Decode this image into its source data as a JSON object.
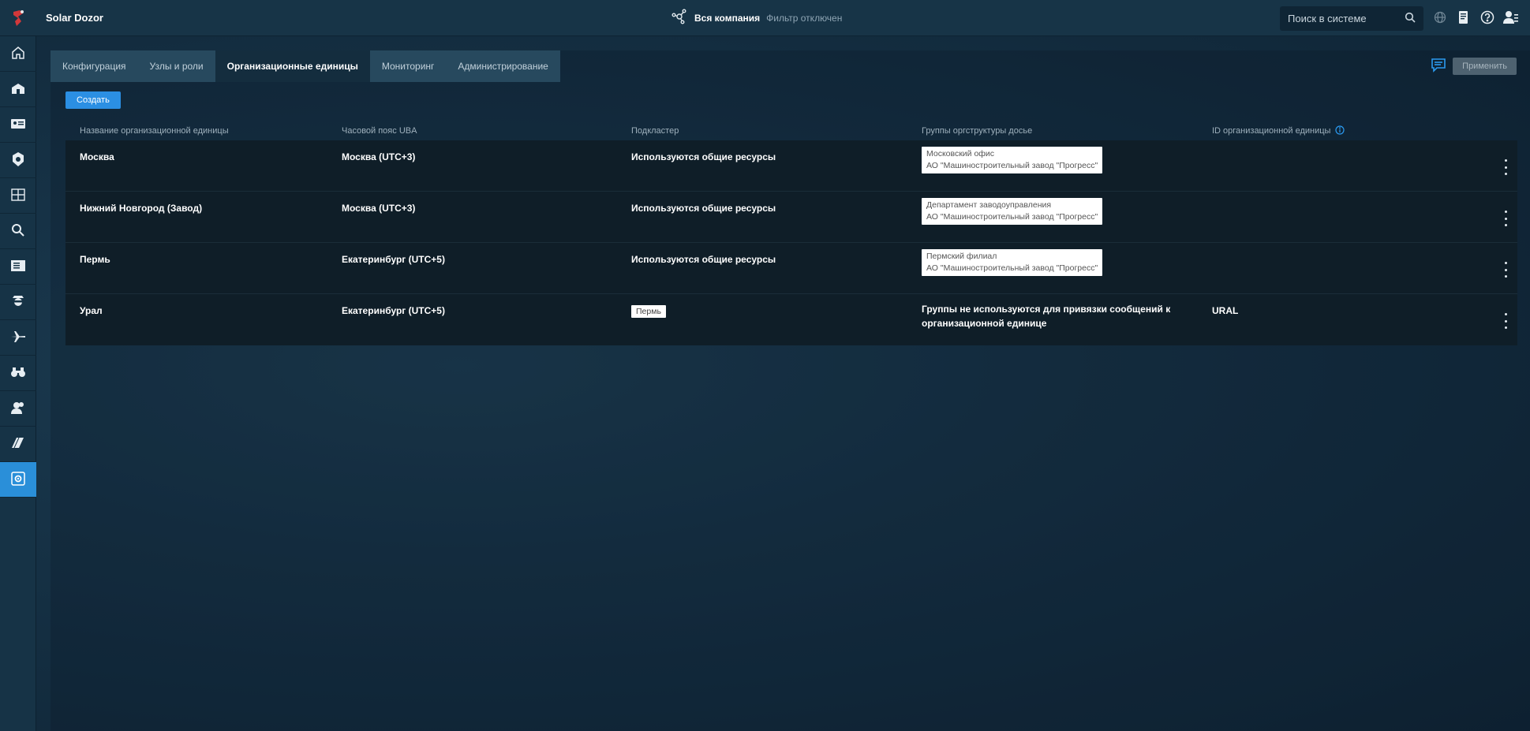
{
  "app": {
    "title": "Solar Dozor",
    "company_label": "Вся компания",
    "filter_state": "Фильтр отключен",
    "search_placeholder": "Поиск в системе"
  },
  "sidebar": {
    "items": [
      {
        "icon": "home-icon"
      },
      {
        "icon": "building-icon"
      },
      {
        "icon": "id-card-icon"
      },
      {
        "icon": "badge-icon"
      },
      {
        "icon": "calendar-icon"
      },
      {
        "icon": "search-icon"
      },
      {
        "icon": "list-icon"
      },
      {
        "icon": "agent-icon"
      },
      {
        "icon": "plane-icon"
      },
      {
        "icon": "binoculars-icon"
      },
      {
        "icon": "users-icon"
      },
      {
        "icon": "books-icon"
      },
      {
        "icon": "gear-icon",
        "active": true
      }
    ]
  },
  "tabs": [
    {
      "label": "Конфигурация",
      "active": false
    },
    {
      "label": "Узлы и роли",
      "active": false
    },
    {
      "label": "Организационные единицы",
      "active": true
    },
    {
      "label": "Мониторинг",
      "active": false
    },
    {
      "label": "Администрирование",
      "active": false
    }
  ],
  "actions": {
    "apply_label": "Применить",
    "create_label": "Создать"
  },
  "table": {
    "headers": {
      "name": "Название организационной единицы",
      "timezone": "Часовой пояс UBA",
      "subcluster": "Подкластер",
      "groups": "Группы оргструктуры досье",
      "id": "ID организационной единицы"
    },
    "rows": [
      {
        "name": "Москва",
        "timezone": "Москва (UTC+3)",
        "subcluster": "Используются общие ресурсы",
        "groups_line1": "Московский офис",
        "groups_line2": "АО \"Машиностроительный завод \"Прогресс\"",
        "id": ""
      },
      {
        "name": "Нижний Новгород (Завод)",
        "timezone": "Москва (UTC+3)",
        "subcluster": "Используются общие ресурсы",
        "groups_line1": "Департамент заводоуправления",
        "groups_line2": "АО \"Машиностроительный завод \"Прогресс\"",
        "id": ""
      },
      {
        "name": "Пермь",
        "timezone": "Екатеринбург (UTC+5)",
        "subcluster": "Используются общие ресурсы",
        "groups_line1": "Пермский филиал",
        "groups_line2": "АО \"Машиностроительный завод \"Прогресс\"",
        "id": ""
      },
      {
        "name": "Урал",
        "timezone": "Екатеринбург (UTC+5)",
        "subcluster_chip": "Пермь",
        "groups_text_line1": "Группы не используются для привязки сообщений к",
        "groups_text_line2": "организационной единице",
        "id": "URAL"
      }
    ]
  }
}
